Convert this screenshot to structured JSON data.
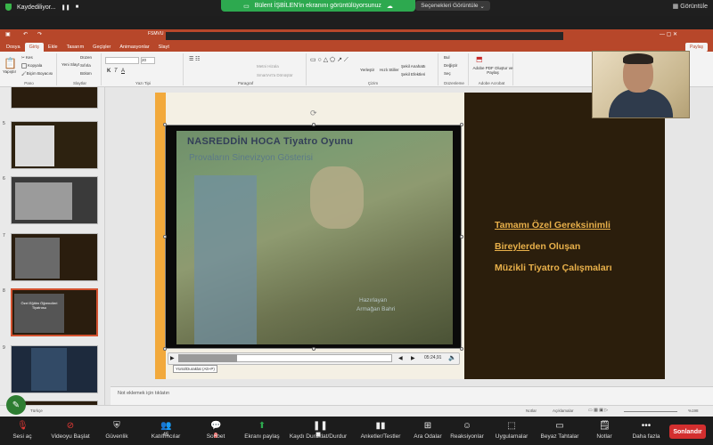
{
  "zoom_top": {
    "recording": "Kaydediliyor...",
    "share_banner": "Bülent İŞBİLEN'in ekranını görüntülüyorsunuz",
    "view_options": "Seçenekleri Görüntüle",
    "gallery": "Görüntüle"
  },
  "ppt": {
    "file_name": "FSMVU",
    "tabs": [
      "Dosya",
      "Giriş",
      "Ekle",
      "Tasarım",
      "Geçişler",
      "Animasyonlar",
      "Slayt"
    ],
    "share": "Paylaş",
    "ribbon": {
      "paste": "Yapıştır",
      "cut": "Kes",
      "copy": "Kopyala",
      "format_painter": "Biçim Boyacısı",
      "clipboard_group": "Pano",
      "new_slide": "Yeni Slayt",
      "layout": "Düzen",
      "reset": "Sıfırla",
      "section": "Bölüm",
      "slides_group": "Slaytlar",
      "font_size": "20",
      "font_group": "Yazı Tipi",
      "text_box": "Metni Hizala",
      "smartart": "SmartArt'a Dönüştür",
      "paragraph_group": "Paragraf",
      "arrange": "Yerleştir",
      "quick_styles": "Hızlı Stiller",
      "shape_outline": "Şekil Anahattı",
      "shape_effects": "Şekil Efektleri",
      "drawing_group": "Çizim",
      "find": "Bul",
      "replace": "Değiştir",
      "select": "Seç",
      "editing_group": "Düzenleme",
      "adobe": "Adobe PDF Oluştur ve Paylaş",
      "adobe_group": "Adobe Acrobat"
    },
    "thumb_numbers": [
      "5",
      "6",
      "7",
      "8",
      "9"
    ],
    "slide8_title": "Özel Eğitim Öğrencileri Tiyatrosu",
    "video_title1": "NASREDDİN HOCA  Tiyatro Oyunu",
    "video_title2": "Provaların Sinevizyon Gösterisi",
    "video_credit1": "Hazırlayan",
    "video_credit2": "Armağan Bahri",
    "video_time": "05:24,91",
    "tooltip": "Yürüt/Duraklat (Alt+P)",
    "right_text": {
      "line1": "Tamamı Özel Gereksinimli",
      "line2a": "Bireyler",
      "line2b": "den Oluşan",
      "line3": "Müzikli  Tiyatro Çalışmaları"
    },
    "notes_placeholder": "Not eklemek için tıklatın",
    "status_lang": "Türkçe",
    "status_notes": "Notlar",
    "status_comments": "Açıklamalar",
    "status_zoom": "%198"
  },
  "zoom_bottom": {
    "items": [
      {
        "label": "Sesi aç",
        "icon": "mic-muted-icon"
      },
      {
        "label": "Videoyu Başlat",
        "icon": "video-off-icon"
      },
      {
        "label": "Güvenlik",
        "icon": "shield-icon"
      },
      {
        "label": "Katılımcılar",
        "icon": "participants-icon",
        "count": "45"
      },
      {
        "label": "Sohbet",
        "icon": "chat-icon",
        "badge": "3"
      },
      {
        "label": "Ekranı paylaş",
        "icon": "share-screen-icon"
      },
      {
        "label": "Kaydı Duraklat/Durdur",
        "icon": "pause-record-icon"
      },
      {
        "label": "Anketler/Testler",
        "icon": "polls-icon"
      },
      {
        "label": "Ara Odalar",
        "icon": "breakout-icon"
      },
      {
        "label": "Reaksiyonlar",
        "icon": "reactions-icon"
      },
      {
        "label": "Uygulamalar",
        "icon": "apps-icon"
      },
      {
        "label": "Beyaz Tahtalar",
        "icon": "whiteboard-icon"
      },
      {
        "label": "Notlar",
        "icon": "notes-icon"
      },
      {
        "label": "Daha fazla",
        "icon": "more-icon"
      }
    ],
    "end": "Sonlandır"
  }
}
